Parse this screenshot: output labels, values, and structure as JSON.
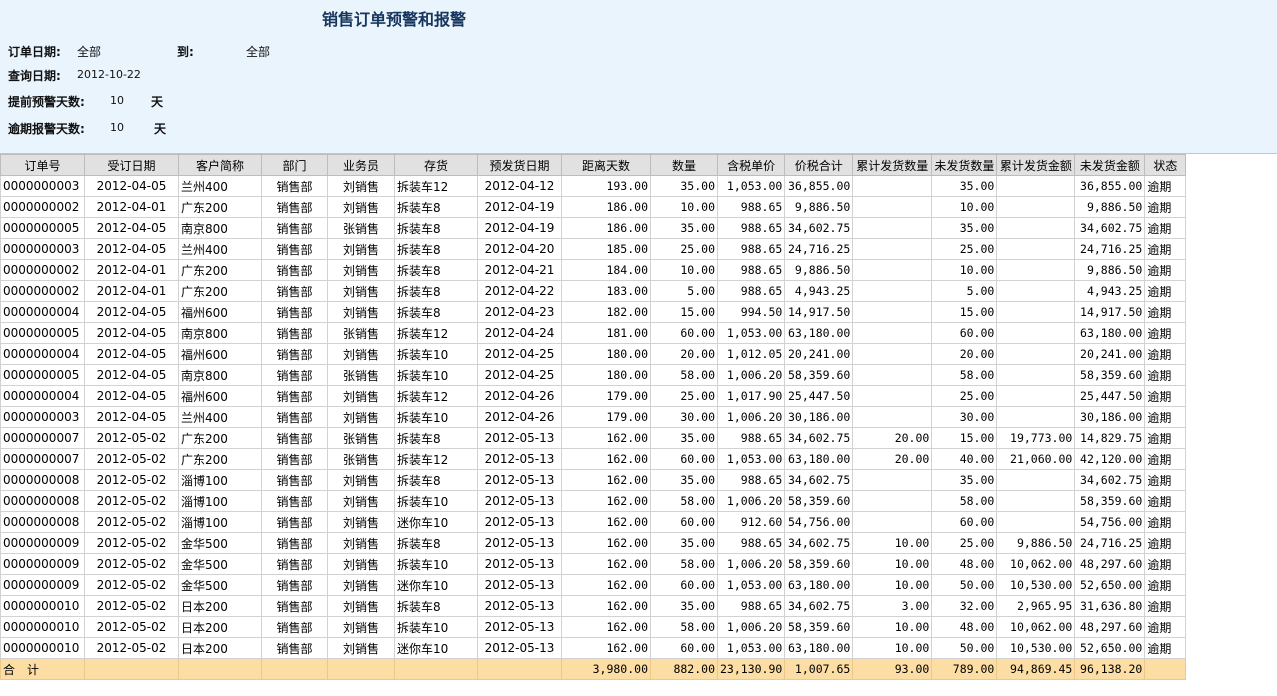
{
  "header": {
    "title": "销售订单预警和报警",
    "order_date_label": "订单日期:",
    "order_date_from": "全部",
    "to_label": "到:",
    "order_date_to": "全部",
    "query_date_label": "查询日期:",
    "query_date": "2012-10-22",
    "advance_warn_label": "提前预警天数:",
    "advance_warn_days": "10",
    "advance_warn_unit": "天",
    "overdue_alarm_label": "逾期报警天数:",
    "overdue_alarm_days": "10",
    "overdue_alarm_unit": "天"
  },
  "table": {
    "columns": [
      "订单号",
      "受订日期",
      "客户简称",
      "部门",
      "业务员",
      "存货",
      "预发货日期",
      "距离天数",
      "数量",
      "含税单价",
      "价税合计",
      "累计发货数量",
      "未发货数量",
      "累计发货金额",
      "未发货金额",
      "状态"
    ],
    "rows": [
      [
        "0000000003",
        "2012-04-05",
        "兰州400",
        "销售部",
        "刘销售",
        "拆装车12",
        "2012-04-12",
        "193.00",
        "35.00",
        "1,053.00",
        "36,855.00",
        "",
        "35.00",
        "",
        "36,855.00",
        "逾期"
      ],
      [
        "0000000002",
        "2012-04-01",
        "广东200",
        "销售部",
        "刘销售",
        "拆装车8",
        "2012-04-19",
        "186.00",
        "10.00",
        "988.65",
        "9,886.50",
        "",
        "10.00",
        "",
        "9,886.50",
        "逾期"
      ],
      [
        "0000000005",
        "2012-04-05",
        "南京800",
        "销售部",
        "张销售",
        "拆装车8",
        "2012-04-19",
        "186.00",
        "35.00",
        "988.65",
        "34,602.75",
        "",
        "35.00",
        "",
        "34,602.75",
        "逾期"
      ],
      [
        "0000000003",
        "2012-04-05",
        "兰州400",
        "销售部",
        "刘销售",
        "拆装车8",
        "2012-04-20",
        "185.00",
        "25.00",
        "988.65",
        "24,716.25",
        "",
        "25.00",
        "",
        "24,716.25",
        "逾期"
      ],
      [
        "0000000002",
        "2012-04-01",
        "广东200",
        "销售部",
        "刘销售",
        "拆装车8",
        "2012-04-21",
        "184.00",
        "10.00",
        "988.65",
        "9,886.50",
        "",
        "10.00",
        "",
        "9,886.50",
        "逾期"
      ],
      [
        "0000000002",
        "2012-04-01",
        "广东200",
        "销售部",
        "刘销售",
        "拆装车8",
        "2012-04-22",
        "183.00",
        "5.00",
        "988.65",
        "4,943.25",
        "",
        "5.00",
        "",
        "4,943.25",
        "逾期"
      ],
      [
        "0000000004",
        "2012-04-05",
        "福州600",
        "销售部",
        "刘销售",
        "拆装车8",
        "2012-04-23",
        "182.00",
        "15.00",
        "994.50",
        "14,917.50",
        "",
        "15.00",
        "",
        "14,917.50",
        "逾期"
      ],
      [
        "0000000005",
        "2012-04-05",
        "南京800",
        "销售部",
        "张销售",
        "拆装车12",
        "2012-04-24",
        "181.00",
        "60.00",
        "1,053.00",
        "63,180.00",
        "",
        "60.00",
        "",
        "63,180.00",
        "逾期"
      ],
      [
        "0000000004",
        "2012-04-05",
        "福州600",
        "销售部",
        "刘销售",
        "拆装车10",
        "2012-04-25",
        "180.00",
        "20.00",
        "1,012.05",
        "20,241.00",
        "",
        "20.00",
        "",
        "20,241.00",
        "逾期"
      ],
      [
        "0000000005",
        "2012-04-05",
        "南京800",
        "销售部",
        "张销售",
        "拆装车10",
        "2012-04-25",
        "180.00",
        "58.00",
        "1,006.20",
        "58,359.60",
        "",
        "58.00",
        "",
        "58,359.60",
        "逾期"
      ],
      [
        "0000000004",
        "2012-04-05",
        "福州600",
        "销售部",
        "刘销售",
        "拆装车12",
        "2012-04-26",
        "179.00",
        "25.00",
        "1,017.90",
        "25,447.50",
        "",
        "25.00",
        "",
        "25,447.50",
        "逾期"
      ],
      [
        "0000000003",
        "2012-04-05",
        "兰州400",
        "销售部",
        "刘销售",
        "拆装车10",
        "2012-04-26",
        "179.00",
        "30.00",
        "1,006.20",
        "30,186.00",
        "",
        "30.00",
        "",
        "30,186.00",
        "逾期"
      ],
      [
        "0000000007",
        "2012-05-02",
        "广东200",
        "销售部",
        "张销售",
        "拆装车8",
        "2012-05-13",
        "162.00",
        "35.00",
        "988.65",
        "34,602.75",
        "20.00",
        "15.00",
        "19,773.00",
        "14,829.75",
        "逾期"
      ],
      [
        "0000000007",
        "2012-05-02",
        "广东200",
        "销售部",
        "张销售",
        "拆装车12",
        "2012-05-13",
        "162.00",
        "60.00",
        "1,053.00",
        "63,180.00",
        "20.00",
        "40.00",
        "21,060.00",
        "42,120.00",
        "逾期"
      ],
      [
        "0000000008",
        "2012-05-02",
        "淄博100",
        "销售部",
        "刘销售",
        "拆装车8",
        "2012-05-13",
        "162.00",
        "35.00",
        "988.65",
        "34,602.75",
        "",
        "35.00",
        "",
        "34,602.75",
        "逾期"
      ],
      [
        "0000000008",
        "2012-05-02",
        "淄博100",
        "销售部",
        "刘销售",
        "拆装车10",
        "2012-05-13",
        "162.00",
        "58.00",
        "1,006.20",
        "58,359.60",
        "",
        "58.00",
        "",
        "58,359.60",
        "逾期"
      ],
      [
        "0000000008",
        "2012-05-02",
        "淄博100",
        "销售部",
        "刘销售",
        "迷你车10",
        "2012-05-13",
        "162.00",
        "60.00",
        "912.60",
        "54,756.00",
        "",
        "60.00",
        "",
        "54,756.00",
        "逾期"
      ],
      [
        "0000000009",
        "2012-05-02",
        "金华500",
        "销售部",
        "刘销售",
        "拆装车8",
        "2012-05-13",
        "162.00",
        "35.00",
        "988.65",
        "34,602.75",
        "10.00",
        "25.00",
        "9,886.50",
        "24,716.25",
        "逾期"
      ],
      [
        "0000000009",
        "2012-05-02",
        "金华500",
        "销售部",
        "刘销售",
        "拆装车10",
        "2012-05-13",
        "162.00",
        "58.00",
        "1,006.20",
        "58,359.60",
        "10.00",
        "48.00",
        "10,062.00",
        "48,297.60",
        "逾期"
      ],
      [
        "0000000009",
        "2012-05-02",
        "金华500",
        "销售部",
        "刘销售",
        "迷你车10",
        "2012-05-13",
        "162.00",
        "60.00",
        "1,053.00",
        "63,180.00",
        "10.00",
        "50.00",
        "10,530.00",
        "52,650.00",
        "逾期"
      ],
      [
        "0000000010",
        "2012-05-02",
        "日本200",
        "销售部",
        "刘销售",
        "拆装车8",
        "2012-05-13",
        "162.00",
        "35.00",
        "988.65",
        "34,602.75",
        "3.00",
        "32.00",
        "2,965.95",
        "31,636.80",
        "逾期"
      ],
      [
        "0000000010",
        "2012-05-02",
        "日本200",
        "销售部",
        "刘销售",
        "拆装车10",
        "2012-05-13",
        "162.00",
        "58.00",
        "1,006.20",
        "58,359.60",
        "10.00",
        "48.00",
        "10,062.00",
        "48,297.60",
        "逾期"
      ],
      [
        "0000000010",
        "2012-05-02",
        "日本200",
        "销售部",
        "刘销售",
        "迷你车10",
        "2012-05-13",
        "162.00",
        "60.00",
        "1,053.00",
        "63,180.00",
        "10.00",
        "50.00",
        "10,530.00",
        "52,650.00",
        "逾期"
      ]
    ],
    "total": [
      "合　计",
      "",
      "",
      "",
      "",
      "",
      "",
      "3,980.00",
      "882.00",
      "23,130.90",
      "1,007.65",
      "93.00",
      "789.00",
      "94,869.45",
      "96,138.20",
      ""
    ]
  }
}
